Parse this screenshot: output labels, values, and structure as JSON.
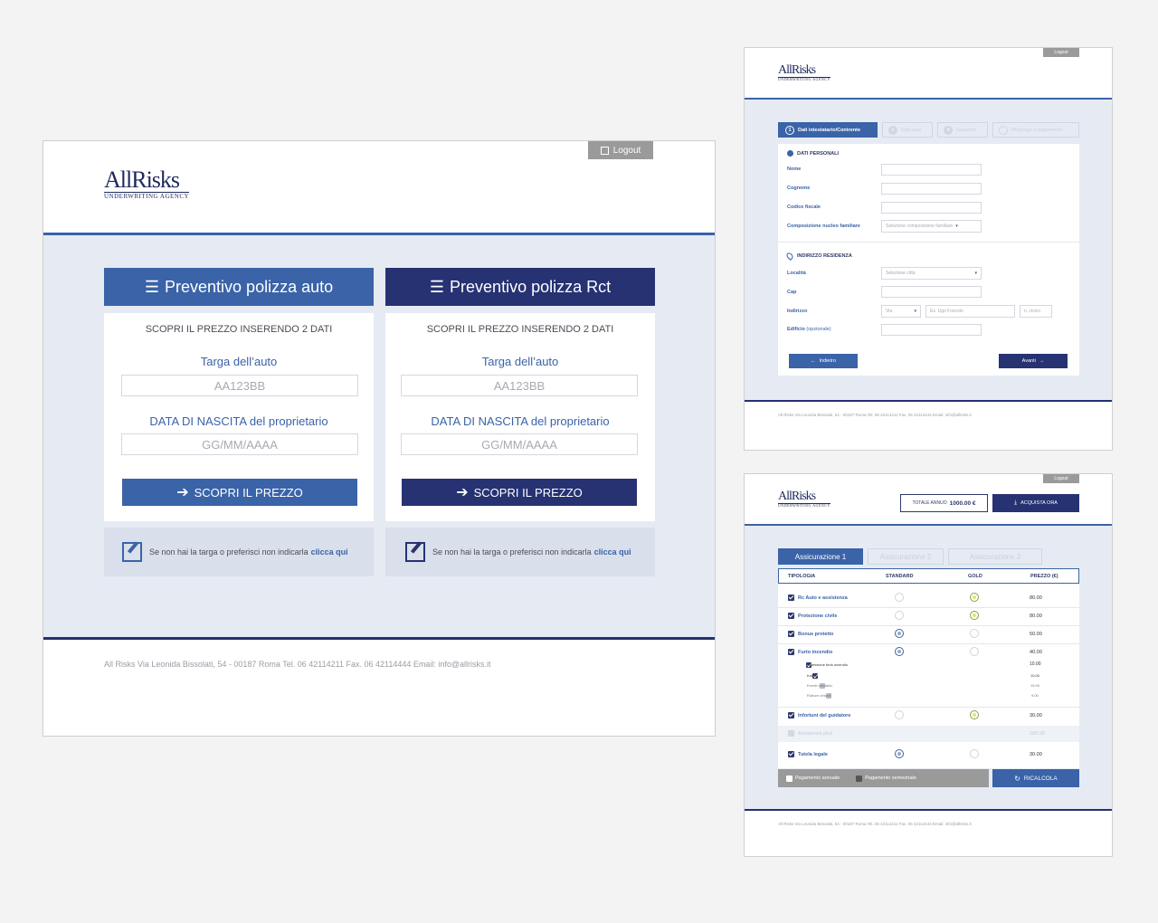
{
  "main": {
    "logout": "Logout",
    "logo": {
      "brand": "AllRisks",
      "sub": "UNDERWRITING AGENCY"
    },
    "cards": [
      {
        "title": "Preventivo polizza auto",
        "subtitle": "SCOPRI IL PREZZO INSERENDO 2 DATI",
        "plate_label": "Targa dell’auto",
        "plate_placeholder": "AA123BB",
        "dob_label": "DATA DI NASCITA del proprietario",
        "dob_placeholder": "GG/MM/AAAA",
        "cta": "SCOPRI IL PREZZO",
        "note": "Se non hai la targa o preferisci non indicarla",
        "note_link": "clicca qui",
        "color": "#3a63a8"
      },
      {
        "title": "Preventivo polizza Rct",
        "subtitle": "SCOPRI IL PREZZO INSERENDO 2 DATI",
        "plate_label": "Targa dell’auto",
        "plate_placeholder": "AA123BB",
        "dob_label": "DATA DI NASCITA del proprietario",
        "dob_placeholder": "GG/MM/AAAA",
        "cta": "SCOPRI IL PREZZO",
        "note": "Se non hai la targa o preferisci non indicarla",
        "note_link": "clicca qui",
        "color": "#263272"
      }
    ],
    "footer": "All Risks Via Leonida Bissolati, 54 - 00187 Roma Tel. 06 42114211 Fax. 06 42114444 Email: info@allrisks.it"
  },
  "form": {
    "logout": "Logout",
    "logo": {
      "brand": "AllRisks",
      "sub": "UNDERWRITING AGENCY"
    },
    "steps": [
      {
        "num": "1",
        "label": "Dati intestatario/Contrente"
      },
      {
        "num": "2",
        "label": "Dati auto"
      },
      {
        "num": "3",
        "label": "Garanzie"
      },
      {
        "num": "",
        "label": "Riepilogo e pagamento"
      }
    ],
    "personal_title": "DATI PERSONALI",
    "personal_fields": [
      "Nome",
      "Cognome",
      "Codice fiscale",
      "Composizione nucleo familiare"
    ],
    "family_select": "Selezione composizione familiare",
    "address_title": "INDIRIZZO RESIDENZA",
    "address_labels": {
      "city": "Località",
      "cap": "Cap",
      "street": "Indirizzo",
      "building": "Edificio",
      "optional": "(opzionale)"
    },
    "city_select": "Selezione città",
    "street_type": "Via",
    "street_placeholder": "Es. Ugo Foscolo",
    "civic_placeholder": "n. civico",
    "back": "Indietro",
    "next": "Avanti",
    "footer": "All Risks Via Leonida Bissolati, 54 - 00187 Roma Tel. 06 42114211 Fax. 06 42114444 Email: info@allrisks.it"
  },
  "summary": {
    "logout": "Logout",
    "logo": {
      "brand": "AllRisks",
      "sub": "UNDERWRITING AGENCY"
    },
    "total_label": "TOTALE ANNUO",
    "total_value": "1000.00 €",
    "buy": "ACQUISTA ORA",
    "tabs": [
      "Assicurazione 1",
      "Assicurazione 2",
      "Assicurazione 3"
    ],
    "columns": [
      "TIPOLOGIA",
      "STANDARD",
      "GOLD",
      "PREZZO (€)"
    ],
    "rows": [
      {
        "name": "Rc Auto e assistenza",
        "price": "80.00",
        "pick": "gold",
        "checked": true
      },
      {
        "name": "Protezione civile",
        "price": "80.00",
        "pick": "gold",
        "checked": true
      },
      {
        "name": "Bonus protetto",
        "price": "50.00",
        "pick": "standard",
        "checked": true
      },
      {
        "name": "Furto incendio",
        "price": "40.00",
        "pick": "standard",
        "checked": true
      },
      {
        "name": "Infortuni del guidatore",
        "price": "30.00",
        "pick": "gold",
        "checked": true
      },
      {
        "name": "Assistenza plus",
        "price": "100.00",
        "pick": "none",
        "checked": false
      },
      {
        "name": "Tutela legale",
        "price": "30.00",
        "pick": "standard",
        "checked": true
      }
    ],
    "subrows": [
      {
        "name": "Estensione furto incendio",
        "price": "10.00",
        "checked": true
      },
      {
        "name": "Kasko",
        "price": "10.00",
        "checked": true
      },
      {
        "name": "Eventi vandalici",
        "price": "15.00",
        "checked": false
      },
      {
        "name": "Rotture cristalli",
        "price": "9.00",
        "checked": false
      }
    ],
    "pay_annual": "Pagamento annuale",
    "pay_semestral": "Pagamento semestrale",
    "recalc": "RICALCOLA",
    "footer": "All Risks Via Leonida Bissolati, 54 - 00187 Roma Tel. 06 42114211 Fax. 06 42114444 Email: info@allrisks.it"
  }
}
